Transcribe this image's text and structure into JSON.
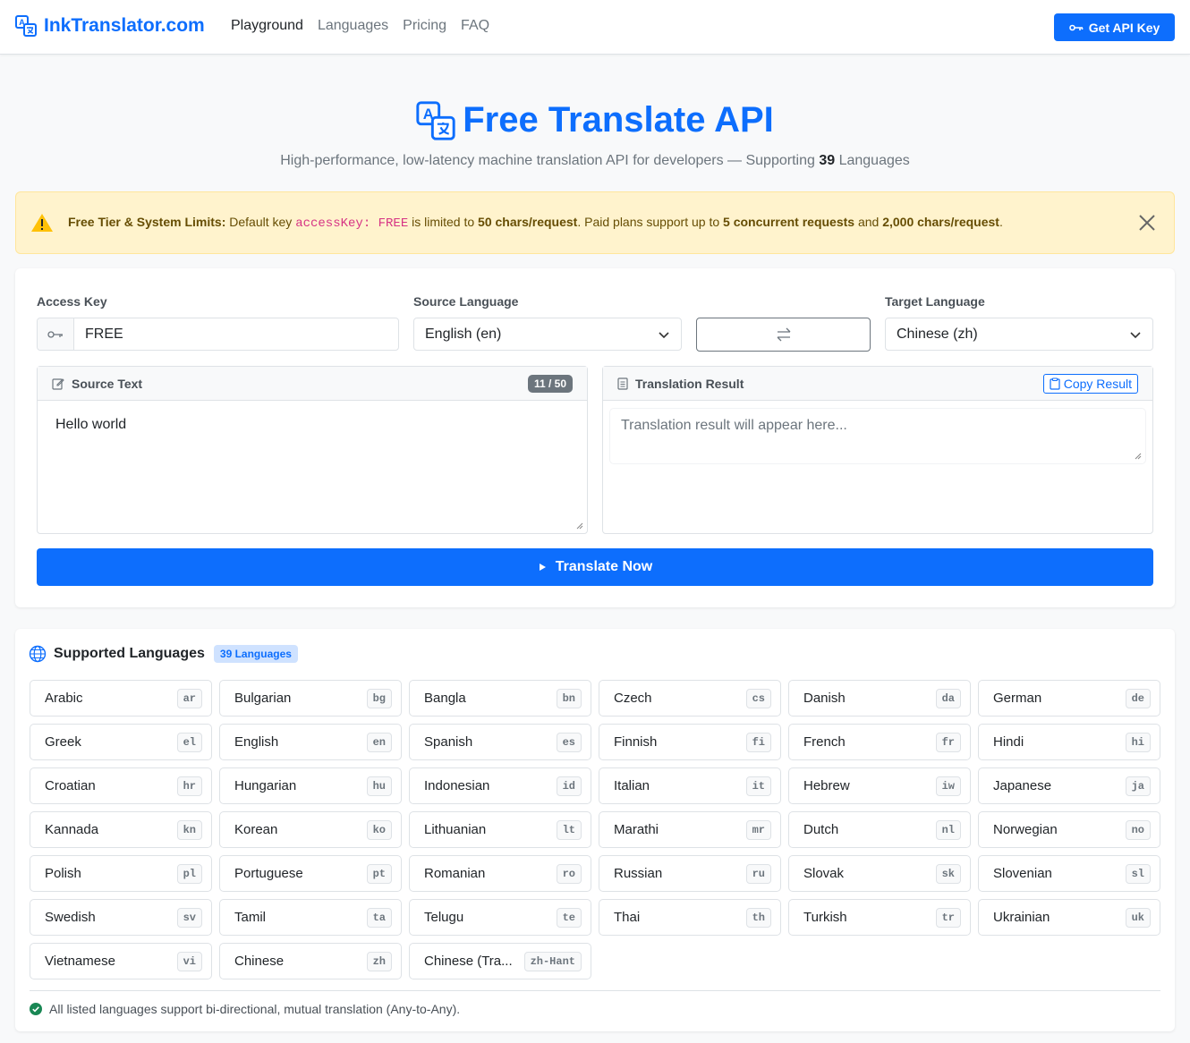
{
  "nav": {
    "brand": "InkTranslator.com",
    "links": [
      "Playground",
      "Languages",
      "Pricing",
      "FAQ"
    ],
    "api_button": "Get API Key"
  },
  "hero": {
    "title": "Free Translate API",
    "subtitle_prefix": "High-performance, low-latency machine translation API for developers — Supporting",
    "count": "39",
    "subtitle_suffix": "Languages"
  },
  "alert": {
    "title": "Free Tier & System Limits:",
    "t1": "Default key",
    "code": "accessKey: FREE",
    "t2": "is limited to",
    "b1": "50 chars/request",
    "t3": ". Paid plans support up to",
    "b2": "5 concurrent requests",
    "t4": "and",
    "b3": "2,000 chars/request",
    "t5": "."
  },
  "form": {
    "access_label": "Access Key",
    "access_value": "FREE",
    "source_label": "Source Language",
    "source_value": "English (en)",
    "target_label": "Target Language",
    "target_value": "Chinese (zh)",
    "source_text_label": "Source Text",
    "char_count": "11 / 50",
    "source_text": "Hello world",
    "result_label": "Translation Result",
    "copy_label": "Copy Result",
    "result_placeholder": "Translation result will appear here...",
    "translate_label": "Translate Now"
  },
  "languages": {
    "title": "Supported Languages",
    "badge": "39 Languages",
    "items": [
      {
        "name": "Arabic",
        "code": "ar"
      },
      {
        "name": "Bulgarian",
        "code": "bg"
      },
      {
        "name": "Bangla",
        "code": "bn"
      },
      {
        "name": "Czech",
        "code": "cs"
      },
      {
        "name": "Danish",
        "code": "da"
      },
      {
        "name": "German",
        "code": "de"
      },
      {
        "name": "Greek",
        "code": "el"
      },
      {
        "name": "English",
        "code": "en"
      },
      {
        "name": "Spanish",
        "code": "es"
      },
      {
        "name": "Finnish",
        "code": "fi"
      },
      {
        "name": "French",
        "code": "fr"
      },
      {
        "name": "Hindi",
        "code": "hi"
      },
      {
        "name": "Croatian",
        "code": "hr"
      },
      {
        "name": "Hungarian",
        "code": "hu"
      },
      {
        "name": "Indonesian",
        "code": "id"
      },
      {
        "name": "Italian",
        "code": "it"
      },
      {
        "name": "Hebrew",
        "code": "iw"
      },
      {
        "name": "Japanese",
        "code": "ja"
      },
      {
        "name": "Kannada",
        "code": "kn"
      },
      {
        "name": "Korean",
        "code": "ko"
      },
      {
        "name": "Lithuanian",
        "code": "lt"
      },
      {
        "name": "Marathi",
        "code": "mr"
      },
      {
        "name": "Dutch",
        "code": "nl"
      },
      {
        "name": "Norwegian",
        "code": "no"
      },
      {
        "name": "Polish",
        "code": "pl"
      },
      {
        "name": "Portuguese",
        "code": "pt"
      },
      {
        "name": "Romanian",
        "code": "ro"
      },
      {
        "name": "Russian",
        "code": "ru"
      },
      {
        "name": "Slovak",
        "code": "sk"
      },
      {
        "name": "Slovenian",
        "code": "sl"
      },
      {
        "name": "Swedish",
        "code": "sv"
      },
      {
        "name": "Tamil",
        "code": "ta"
      },
      {
        "name": "Telugu",
        "code": "te"
      },
      {
        "name": "Thai",
        "code": "th"
      },
      {
        "name": "Turkish",
        "code": "tr"
      },
      {
        "name": "Ukrainian",
        "code": "uk"
      },
      {
        "name": "Vietnamese",
        "code": "vi"
      },
      {
        "name": "Chinese",
        "code": "zh"
      },
      {
        "name": "Chinese (Tra...",
        "code": "zh-Hant"
      }
    ],
    "footer": "All listed languages support bi-directional, mutual translation (Any-to-Any)."
  },
  "colors": {
    "primary": "#0d6efd",
    "warning_bg": "#fff3cd",
    "success": "#198754"
  }
}
